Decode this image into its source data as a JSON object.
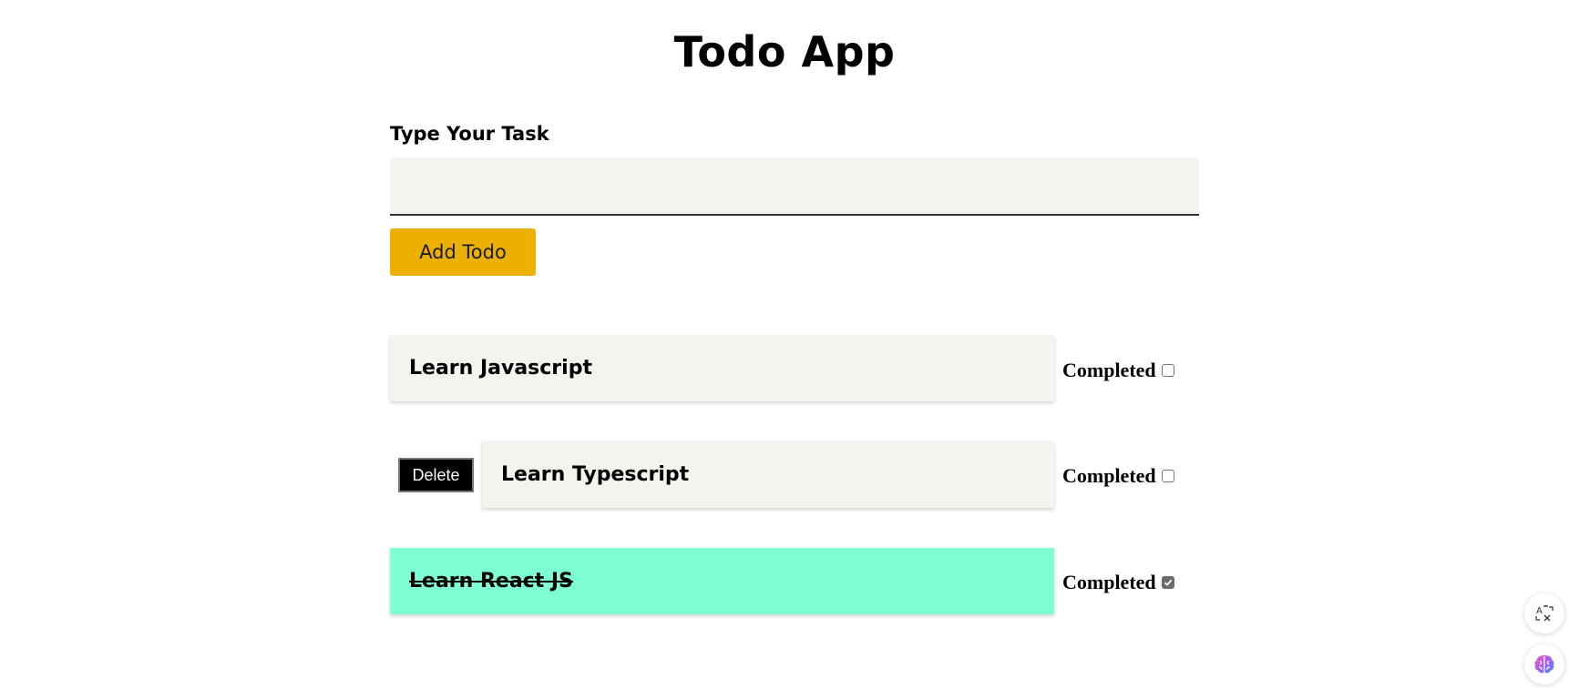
{
  "app": {
    "title": "Todo App"
  },
  "form": {
    "label": "Type Your Task",
    "input_value": "",
    "input_placeholder": "",
    "add_button_label": "Add Todo"
  },
  "todos": [
    {
      "text": "Learn Javascript",
      "completed_label": "Completed",
      "completed": false
    },
    {
      "text": "Learn Typescript",
      "completed_label": "Completed",
      "completed": false,
      "delete_label": "Delete"
    },
    {
      "text": "Learn React JS",
      "completed_label": "Completed",
      "completed": true
    }
  ],
  "colors": {
    "accent_button": "#ecb100",
    "card_background": "#f5f3ee",
    "completed_card_background": "#7fffd4",
    "delete_button": "#000000"
  },
  "floating_icons": [
    "translate-icon",
    "brain-icon"
  ]
}
